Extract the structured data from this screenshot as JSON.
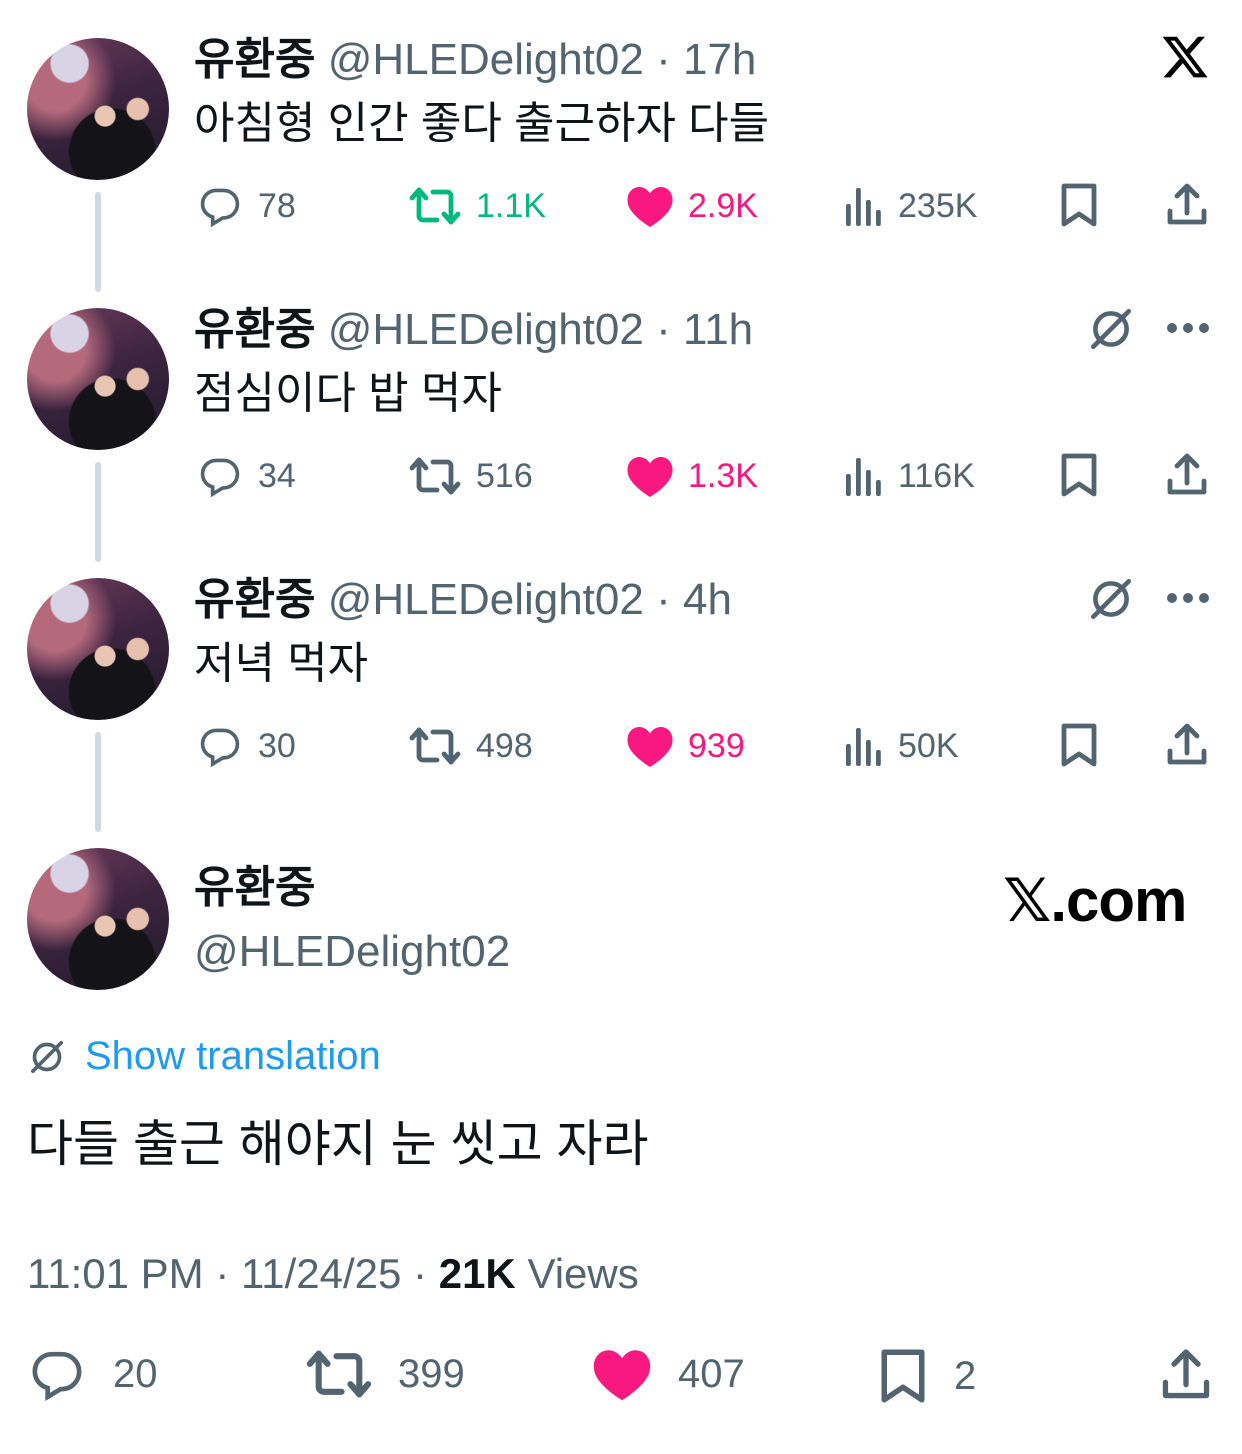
{
  "tweets": [
    {
      "name": "유환중",
      "handle": "@HLEDelight02",
      "dot": "·",
      "time": "17h",
      "text": "아침형 인간 좋다 출근하자 다들",
      "replies": "78",
      "retweets": "1.1K",
      "likes": "2.9K",
      "views": "235K",
      "retweeted": true,
      "liked": true
    },
    {
      "name": "유환중",
      "handle": "@HLEDelight02",
      "dot": "·",
      "time": "11h",
      "text": "점심이다 밥 먹자",
      "replies": "34",
      "retweets": "516",
      "likes": "1.3K",
      "views": "116K",
      "retweeted": false,
      "liked": true
    },
    {
      "name": "유환중",
      "handle": "@HLEDelight02",
      "dot": "·",
      "time": "4h",
      "text": "저녁 먹자",
      "replies": "30",
      "retweets": "498",
      "likes": "939",
      "views": "50K",
      "retweeted": false,
      "liked": true
    }
  ],
  "main": {
    "name": "유환중",
    "handle": "@HLEDelight02",
    "brand": "𝕏.com",
    "show_translation": "Show translation",
    "text": "다들 출근 해야지 눈 씻고 자라",
    "time": "11:01 PM",
    "date": "11/24/25",
    "sep": "·",
    "views_count": "21K",
    "views_label": "Views",
    "replies": "20",
    "retweets": "399",
    "likes": "407",
    "bookmarks": "2"
  },
  "colors": {
    "accent": "#1d9bf0",
    "retweet_green": "#00ba7c",
    "like_pink": "#f91880",
    "secondary_text": "#536471",
    "thread_line": "#cfd9de"
  },
  "icons": [
    "x-logo-icon",
    "reply-icon",
    "retweet-icon",
    "heart-icon",
    "views-icon",
    "bookmark-icon",
    "share-icon",
    "translate-icon",
    "more-icon"
  ]
}
